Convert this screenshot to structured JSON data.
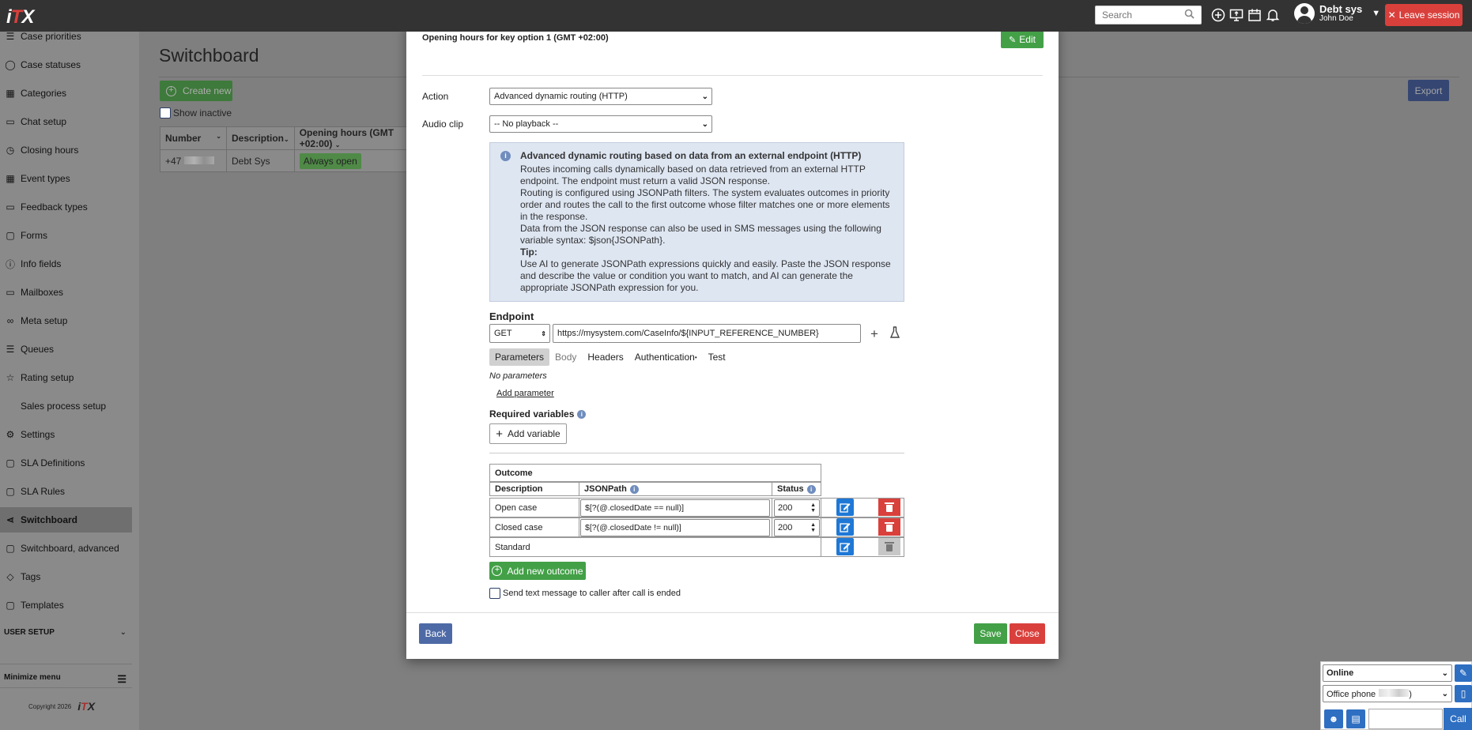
{
  "topbar": {
    "logo": "iTX",
    "search_placeholder": "Search",
    "user_name": "Debt sys",
    "user_sub": "John Doe",
    "leave_label": "Leave session"
  },
  "sidebar": {
    "items": [
      {
        "label": "Case priorities",
        "icon": "list-icon"
      },
      {
        "label": "Case statuses",
        "icon": "circle-icon"
      },
      {
        "label": "Categories",
        "icon": "grid-icon"
      },
      {
        "label": "Chat setup",
        "icon": "chat-icon"
      },
      {
        "label": "Closing hours",
        "icon": "clock-icon"
      },
      {
        "label": "Event types",
        "icon": "calendar-icon"
      },
      {
        "label": "Feedback types",
        "icon": "feedback-icon"
      },
      {
        "label": "Forms",
        "icon": "file-icon"
      },
      {
        "label": "Info fields",
        "icon": "info-icon"
      },
      {
        "label": "Mailboxes",
        "icon": "mailbox-icon"
      },
      {
        "label": "Meta setup",
        "icon": "infinity-icon"
      },
      {
        "label": "Queues",
        "icon": "queue-icon"
      },
      {
        "label": "Rating setup",
        "icon": "star-icon"
      },
      {
        "label": "Sales process setup",
        "icon": ""
      },
      {
        "label": "Settings",
        "icon": "gear-icon"
      },
      {
        "label": "SLA Definitions",
        "icon": "sla-icon"
      },
      {
        "label": "SLA Rules",
        "icon": "rules-icon"
      },
      {
        "label": "Switchboard",
        "icon": "share-icon"
      },
      {
        "label": "Switchboard, advanced",
        "icon": "share-advanced-icon"
      },
      {
        "label": "Tags",
        "icon": "tag-icon"
      },
      {
        "label": "Templates",
        "icon": "template-icon"
      }
    ],
    "section_user_setup": "USER SETUP",
    "minimize_label": "Minimize menu",
    "copyright": "Copyright 2026",
    "copyright_logo": "iTX"
  },
  "main": {
    "title": "Switchboard",
    "create_label": "Create new",
    "export_label": "Export",
    "show_inactive": "Show inactive",
    "table": {
      "headers": [
        "Number",
        "Description",
        "Opening hours (GMT +02:00)"
      ],
      "row": {
        "number": "+47",
        "description": "Debt Sys",
        "hours": "Always open"
      }
    }
  },
  "modal": {
    "header": "Opening hours for key option 1 (GMT +02:00)",
    "edit_label": "Edit",
    "action_label": "Action",
    "action_value": "Advanced dynamic routing (HTTP)",
    "audio_label": "Audio clip",
    "audio_value": "-- No playback --",
    "info": {
      "title": "Advanced dynamic routing based on data from an external endpoint (HTTP)",
      "p1": "Routes incoming calls dynamically based on data retrieved from an external HTTP endpoint. The endpoint must return a valid JSON response.",
      "p2": "Routing is configured using JSONPath filters. The system evaluates outcomes in priority order and routes the call to the first outcome whose filter matches one or more elements in the response.",
      "p3": "Data from the JSON response can also be used in SMS messages using the following variable syntax: $json{JSONPath}.",
      "tip_label": "Tip:",
      "p4": "Use AI to generate JSONPath expressions quickly and easily. Paste the JSON response and describe the value or condition you want to match, and AI can generate the appropriate JSONPath expression for you."
    },
    "endpoint_label": "Endpoint",
    "method": "GET",
    "url": "https://mysystem.com/CaseInfo/${INPUT_REFERENCE_NUMBER}",
    "tabs": [
      "Parameters",
      "Body",
      "Headers",
      "Authentication",
      "Test"
    ],
    "no_params": "No parameters",
    "add_param": "Add parameter",
    "required_vars": "Required variables",
    "add_variable": "Add variable",
    "outcome": {
      "title": "Outcome",
      "col_desc": "Description",
      "col_path": "JSONPath",
      "col_status": "Status",
      "rows": [
        {
          "desc": "Open case",
          "path": "$[?(@.closedDate == null)]",
          "status": "200"
        },
        {
          "desc": "Closed case",
          "path": "$[?(@.closedDate != null)]",
          "status": "200"
        },
        {
          "desc": "Standard",
          "path": "",
          "status": ""
        }
      ],
      "add_label": "Add new outcome"
    },
    "send_sms": "Send text message to caller after call is ended",
    "back_label": "Back",
    "save_label": "Save",
    "close_label": "Close"
  },
  "widget": {
    "status": "Online",
    "phone": "Office phone",
    "call_label": "Call"
  }
}
